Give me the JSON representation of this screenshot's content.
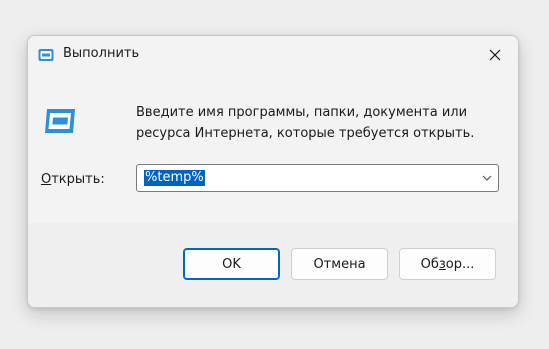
{
  "window": {
    "title": "Выполнить"
  },
  "dialog": {
    "description": "Введите имя программы, папки, документа или ресурса Интернета, которые требуется открыть.",
    "open_label_accel": "О",
    "open_label_rest": "ткрыть:",
    "input_value": "%temp%"
  },
  "buttons": {
    "ok": "OK",
    "cancel": "Отмена",
    "browse_pre": "Об",
    "browse_accel": "з",
    "browse_post": "ор..."
  },
  "icons": {
    "title": "run-icon",
    "main": "run-icon",
    "close": "close-icon",
    "dropdown": "chevron-down-icon"
  },
  "colors": {
    "accent": "#0067c0",
    "selection": "#0063c4"
  }
}
